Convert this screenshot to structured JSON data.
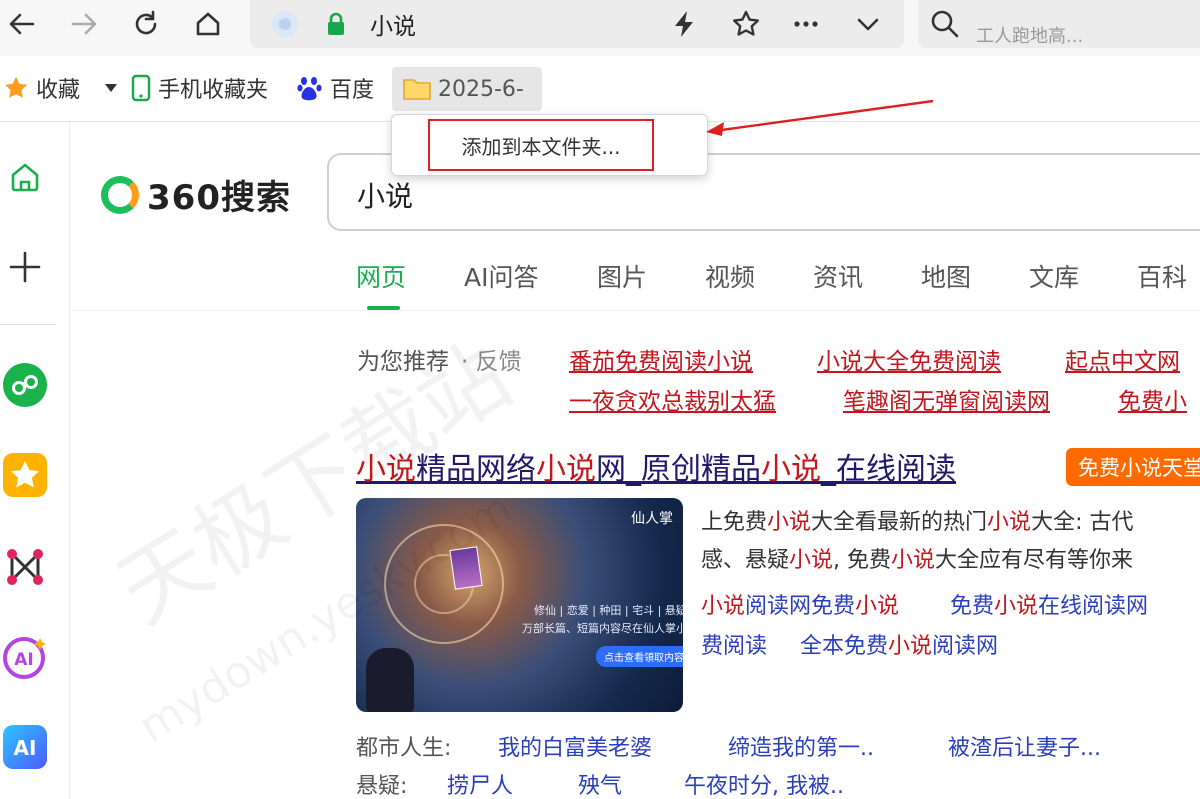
{
  "toolbar": {
    "address": "小说",
    "search_hint": "工人跑地高..."
  },
  "bookmarks": [
    {
      "label": "收藏",
      "icon": "star-icon"
    },
    {
      "label": "手机收藏夹",
      "icon": "phone-icon"
    },
    {
      "label": "百度",
      "icon": "baidu-paw-icon"
    },
    {
      "label": "2025-6-",
      "icon": "folder-icon"
    }
  ],
  "popup": {
    "item": "添加到本文件夹..."
  },
  "colors": {
    "accent_green": "#1aae4f",
    "highlight_red": "#c4161c",
    "link_blue": "#2a3fbd",
    "annotation_red": "#e02020",
    "badge_orange": "#ff6a00"
  },
  "logo": {
    "text": "360搜索"
  },
  "search": {
    "query": "小说"
  },
  "tabs": [
    "网页",
    "AI问答",
    "图片",
    "视频",
    "资讯",
    "地图",
    "文库",
    "百科"
  ],
  "active_tab": "网页",
  "recommend": {
    "label": "为您推荐",
    "feedback": "· 反馈",
    "row1": [
      "番茄免费阅读小说",
      "小说大全免费阅读",
      "起点中文网"
    ],
    "row2": [
      "一夜贪欢总裁别太猛",
      "笔趣阁无弹窗阅读网",
      "免费小"
    ]
  },
  "result": {
    "title_parts": [
      "小说",
      "精品网络",
      "小说",
      "网_原创精品",
      "小说",
      "_在线阅读"
    ],
    "badge": "免费小说天堂",
    "thumb": {
      "brand": "仙人掌",
      "tags": "修仙 | 恋爱 | 种田 | 宅斗 | 悬疑",
      "sub": "万部长篇、短篇内容尽在仙人掌小说",
      "cta": "点击查看領取内容"
    },
    "desc_line1": [
      "上免费",
      "小说",
      "大全看最新的热门",
      "小说",
      "大全: 古代"
    ],
    "desc_line2": [
      "感、悬疑",
      "小说",
      ", 免费",
      "小说",
      "大全应有尽有等你来"
    ],
    "links_row1": [
      [
        "小说",
        "阅读网免费",
        "小说"
      ],
      [
        "免费",
        "小说",
        "在线阅读网"
      ]
    ],
    "links_row2": [
      [
        "费阅读"
      ],
      [
        "全本免费",
        "小说",
        "阅读网"
      ]
    ],
    "cat1_label": "都市人生:",
    "cat1_links": [
      "我的白富美老婆",
      "缔造我的第一..",
      "被渣后让妻子..."
    ],
    "cat2_label": "悬疑:",
    "cat2_links": [
      "捞尸人",
      "殃气",
      "午夜时分, 我被.."
    ]
  },
  "watermark": {
    "main": "天极下载站",
    "sub": "mydown.yesky.com"
  }
}
